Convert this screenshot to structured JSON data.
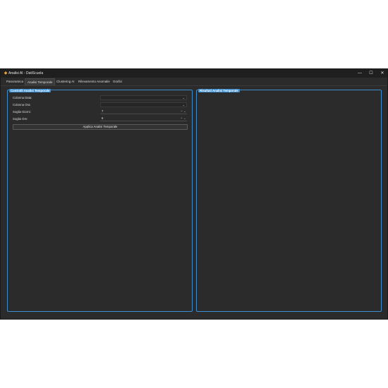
{
  "window": {
    "title": "Analisi AI - DatiScuola",
    "icon": "app-icon",
    "controls": {
      "minimize": "—",
      "maximize": "☐",
      "close": "✕"
    }
  },
  "tabs": [
    {
      "label": "Panoramica",
      "active": false
    },
    {
      "label": "Analisi Temporale",
      "active": true
    },
    {
      "label": "Clustering AI",
      "active": false
    },
    {
      "label": "Rilevamento Anomalie",
      "active": false
    },
    {
      "label": "Grafici",
      "active": false
    }
  ],
  "controls_panel": {
    "title": "Controlli Analisi Temporale",
    "fields": {
      "colonna_data": {
        "label": "Colonna Data:",
        "value": ""
      },
      "colonna_ora": {
        "label": "Colonna Ora:",
        "value": ""
      },
      "soglia_giorni": {
        "label": "Soglia Giorni:",
        "value": "7"
      },
      "soglia_ore": {
        "label": "Soglia Ore:",
        "value": "6"
      }
    },
    "apply_button": "Applica Analisi Temporale"
  },
  "results_panel": {
    "title": "Risultati Analisi Temporale"
  },
  "colors": {
    "accent": "#3d8fd1",
    "background": "#2b2b2b",
    "titlebar": "#1f1f1f"
  }
}
